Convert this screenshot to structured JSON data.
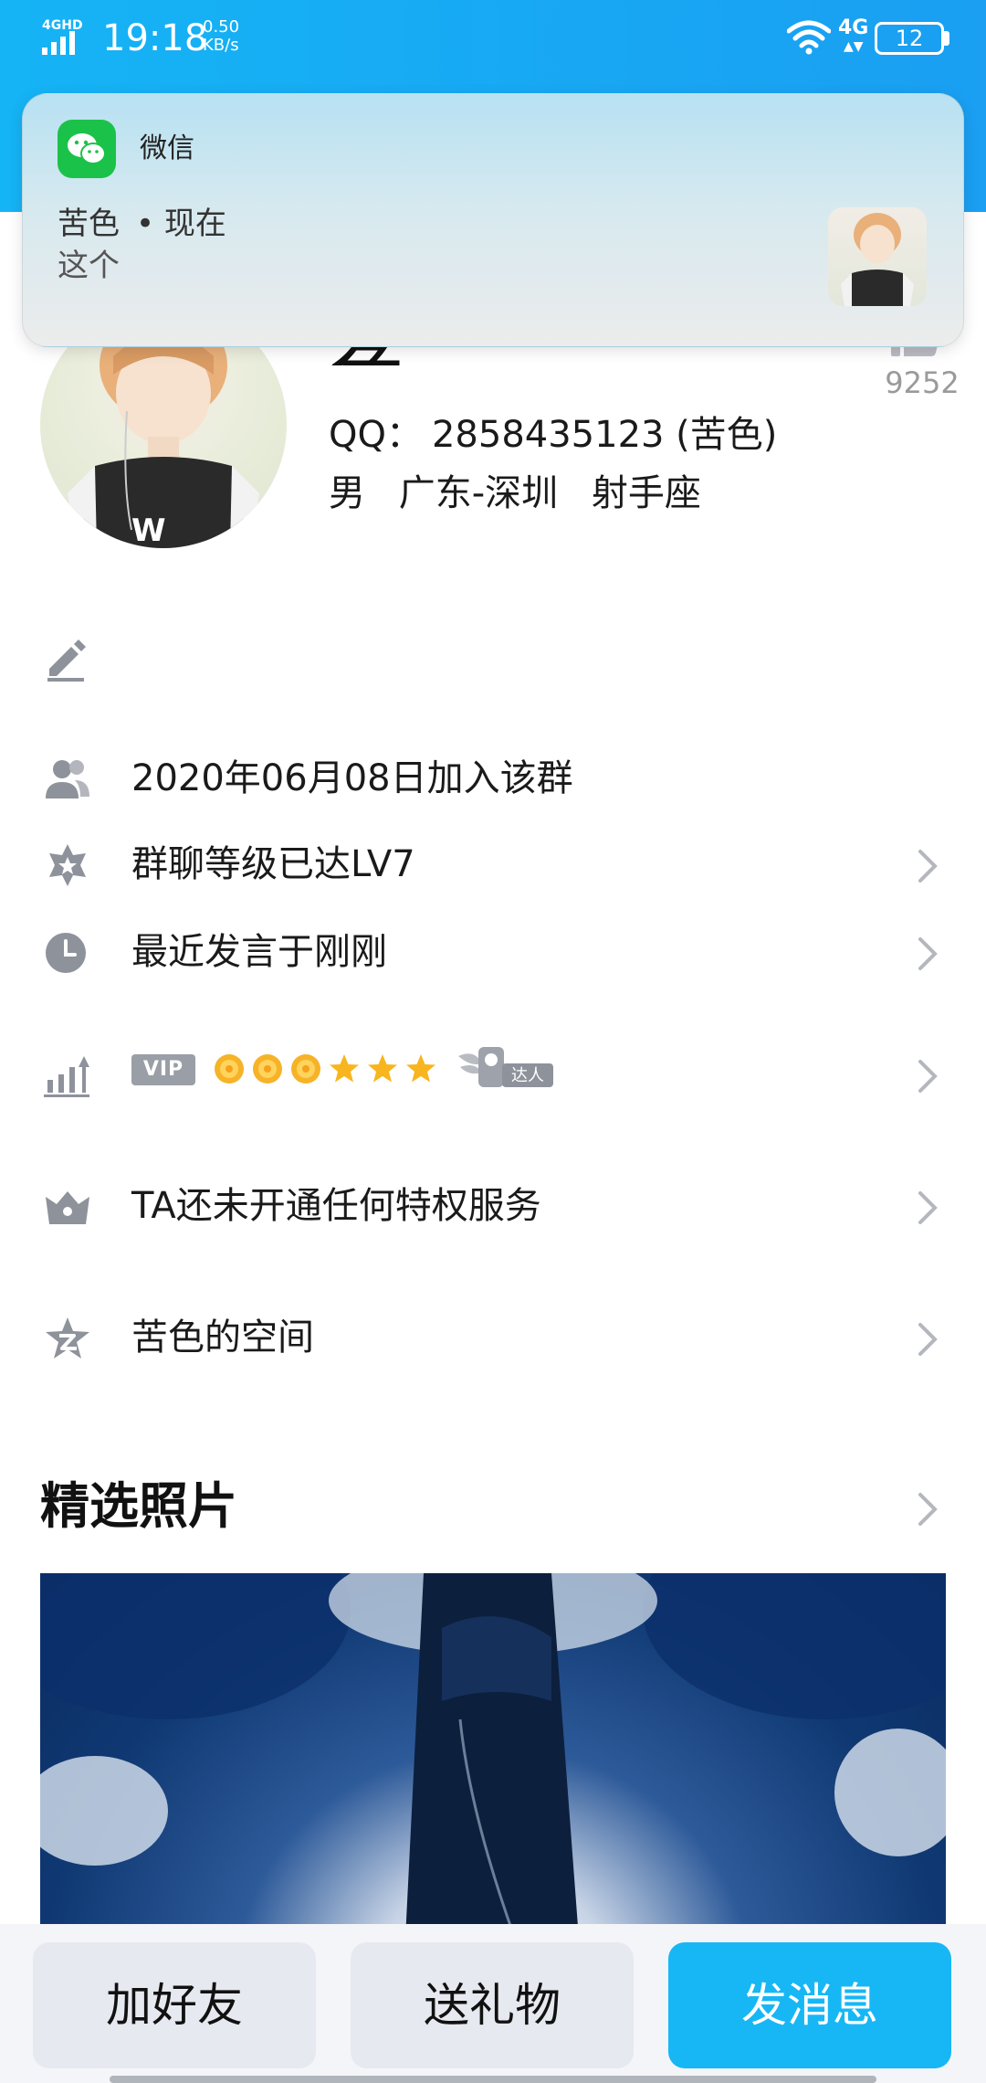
{
  "status_bar": {
    "time": "19:18",
    "speed": "0.50",
    "speed_unit": "KB/s",
    "network": "4G",
    "battery": "12",
    "signal_label": "4GHD"
  },
  "notification": {
    "app_name": "微信",
    "sender": "苦色",
    "time": "• 现在",
    "message": "这个"
  },
  "profile": {
    "name": "苦色",
    "qq_label": "QQ：",
    "qq_value": "2858435123 (苦色)",
    "gender": "男",
    "location": "广东-深圳",
    "zodiac": "射手座",
    "like_count": "9252"
  },
  "rows": {
    "join_date": "2020年06月08日加入该群",
    "group_level": "群聊等级已达LV7",
    "last_speak": "最近发言于刚刚",
    "vip_badge": "VIP",
    "daren": "达人",
    "privilege": "TA还未开通任何特权服务",
    "space": "苦色的空间"
  },
  "photos": {
    "title": "精选照片"
  },
  "bottom": {
    "add_friend": "加好友",
    "send_gift": "送礼物",
    "send_message": "发消息"
  },
  "colors": {
    "header_blue": "#15b4f5",
    "accent_button": "#17b7f5",
    "wechat_green": "#1bc249",
    "icon_gray": "#8e929b"
  },
  "vip_level_icons": [
    "sun-icon",
    "sun-icon",
    "sun-icon",
    "star-icon",
    "star-icon",
    "star-icon"
  ]
}
